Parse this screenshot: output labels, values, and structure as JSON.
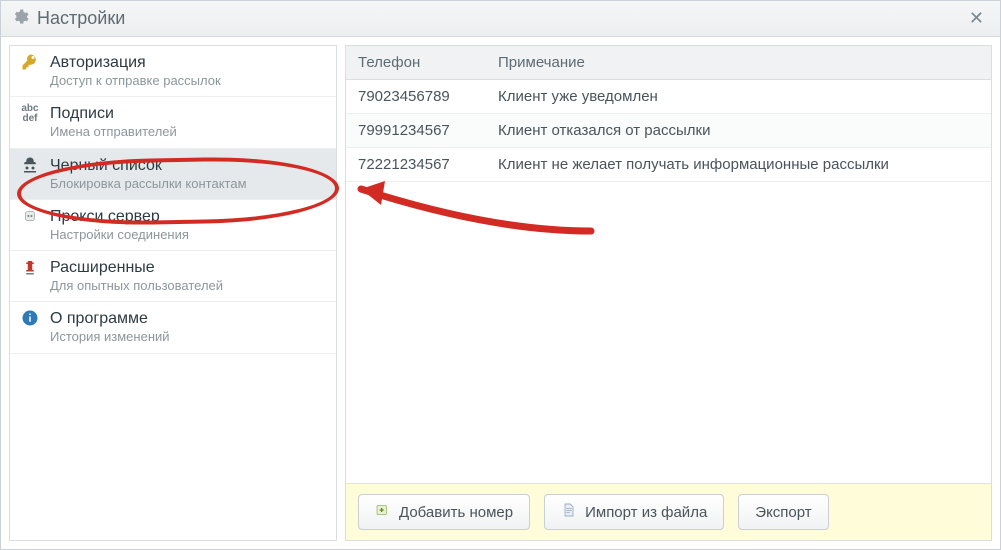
{
  "window": {
    "title": "Настройки"
  },
  "sidebar": {
    "items": [
      {
        "title": "Авторизация",
        "subtitle": "Доступ к отправке рассылок"
      },
      {
        "title": "Подписи",
        "subtitle": "Имена отправителей"
      },
      {
        "title": "Черный список",
        "subtitle": "Блокировка рассылки контактам"
      },
      {
        "title": "Прокси сервер",
        "subtitle": "Настройки соединения"
      },
      {
        "title": "Расширенные",
        "subtitle": "Для опытных пользователей"
      },
      {
        "title": "О программе",
        "subtitle": "История изменений"
      }
    ],
    "selected_index": 2
  },
  "table": {
    "columns": {
      "phone": "Телефон",
      "note": "Примечание"
    },
    "rows": [
      {
        "phone": "79023456789",
        "note": "Клиент уже уведомлен"
      },
      {
        "phone": "79991234567",
        "note": "Клиент отказался от рассылки"
      },
      {
        "phone": "72221234567",
        "note": "Клиент не желает получать информационные рассылки"
      }
    ]
  },
  "toolbar": {
    "add": "Добавить номер",
    "import": "Импорт из файла",
    "export": "Экспорт"
  }
}
